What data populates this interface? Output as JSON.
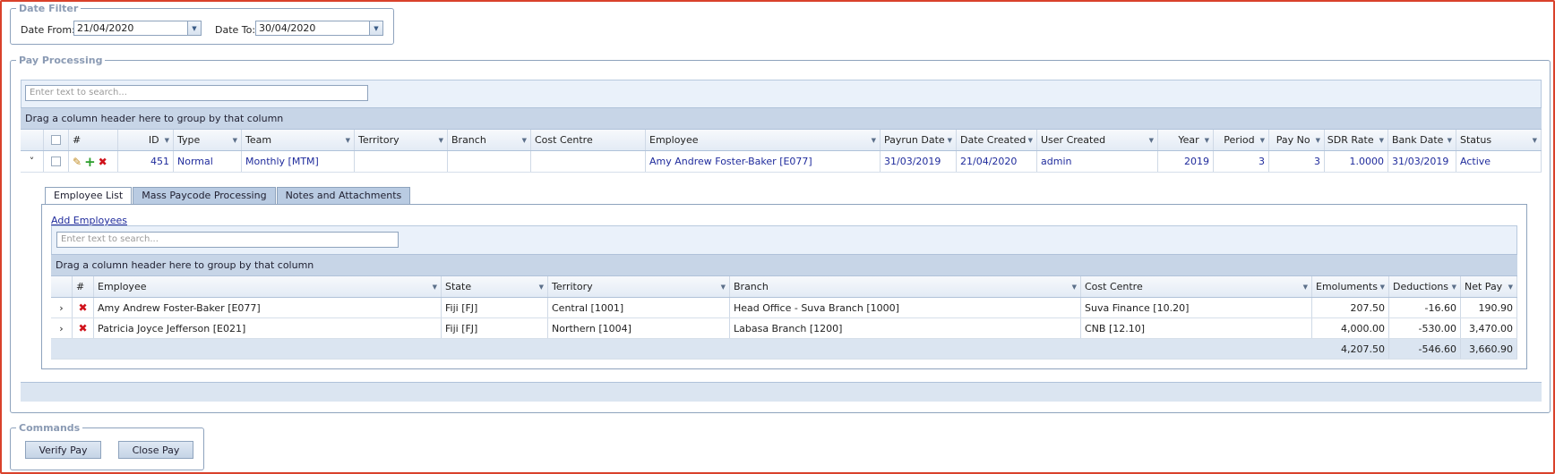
{
  "date_filter": {
    "legend": "Date Filter",
    "from_label": "Date From:",
    "from_value": "21/04/2020",
    "to_label": "Date To:",
    "to_value": "30/04/2020"
  },
  "pay_processing": {
    "legend": "Pay Processing",
    "search_placeholder": "Enter text to search...",
    "group_hint": "Drag a column header here to group by that column",
    "columns": [
      "#",
      "ID",
      "Type",
      "Team",
      "Territory",
      "Branch",
      "Cost Centre",
      "Employee",
      "Payrun Date",
      "Date Created",
      "User Created",
      "Year",
      "Period",
      "Pay No",
      "SDR Rate",
      "Bank Date",
      "Status"
    ],
    "row": {
      "id": "451",
      "type": "Normal",
      "team": "Monthly [MTM]",
      "territory": "",
      "branch": "",
      "cost_centre": "",
      "employee": "Amy Andrew Foster-Baker [E077]",
      "payrun_date": "31/03/2019",
      "date_created": "21/04/2020",
      "user_created": "admin",
      "year": "2019",
      "period": "3",
      "pay_no": "3",
      "sdr_rate": "1.0000",
      "bank_date": "31/03/2019",
      "status": "Active"
    },
    "tabs": [
      "Employee List",
      "Mass Paycode Processing",
      "Notes and Attachments"
    ],
    "add_employees_link": "Add Employees",
    "detail": {
      "search_placeholder": "Enter text to search...",
      "group_hint": "Drag a column header here to group by that column",
      "columns": [
        "#",
        "Employee",
        "State",
        "Territory",
        "Branch",
        "Cost Centre",
        "Emoluments",
        "Deductions",
        "Net Pay"
      ],
      "rows": [
        {
          "employee": "Amy Andrew Foster-Baker [E077]",
          "state": "Fiji [FJ]",
          "territory": "Central [1001]",
          "branch": "Head Office - Suva Branch [1000]",
          "cost_centre": "Suva Finance [10.20]",
          "emoluments": "207.50",
          "deductions": "-16.60",
          "net_pay": "190.90"
        },
        {
          "employee": "Patricia Joyce Jefferson [E021]",
          "state": "Fiji [FJ]",
          "territory": "Northern [1004]",
          "branch": "Labasa Branch [1200]",
          "cost_centre": "CNB [12.10]",
          "emoluments": "4,000.00",
          "deductions": "-530.00",
          "net_pay": "3,470.00"
        }
      ],
      "totals": {
        "emoluments": "4,207.50",
        "deductions": "-546.60",
        "net_pay": "3,660.90"
      }
    }
  },
  "commands": {
    "legend": "Commands",
    "verify_label": "Verify Pay",
    "close_label": "Close Pay"
  }
}
